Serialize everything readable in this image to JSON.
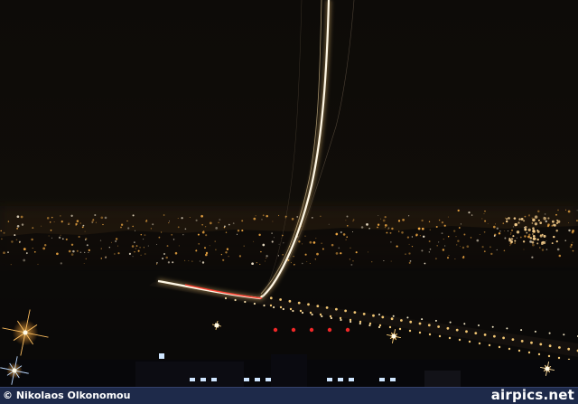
{
  "photo": {
    "subject": "long-exposure-aircraft-takeoff-at-night",
    "colors": {
      "sky": "#0c0a08",
      "city_lights": "#ffb347",
      "runway_lights": "#ffd27a",
      "red_lights": "#ff2a2a",
      "trail": "#fff8e6",
      "credit_bar": "#1e2a4a"
    }
  },
  "credit": {
    "photographer": "© Nikolaos Olkonomou",
    "site": "airpics.net"
  }
}
